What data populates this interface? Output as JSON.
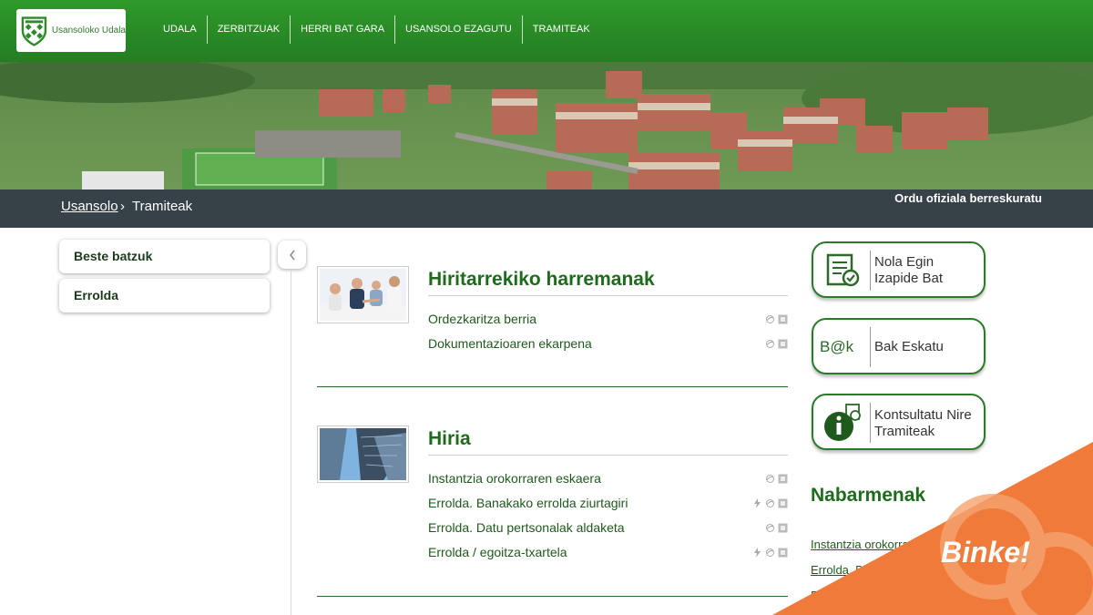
{
  "header": {
    "logo_text": "Usansoloko Udala",
    "nav": [
      "UDALA",
      "ZERBITZUAK",
      "HERRI BAT GARA",
      "USANSOLO EZAGUTU",
      "TRAMITEAK"
    ]
  },
  "breadcrumb": {
    "home": "Usansolo",
    "separator": "›",
    "current": "Tramiteak",
    "ordu": "Ordu ofiziala berreskuratu"
  },
  "sidebar": {
    "items": [
      "Beste batzuk",
      "Errolda"
    ]
  },
  "sections": [
    {
      "title": "Hiritarrekiko harremanak",
      "items": [
        "Ordezkaritza berria",
        "Dokumentazioaren ekarpena"
      ]
    },
    {
      "title": "Hiria",
      "items": [
        "Instantzia orokorraren eskaera",
        "Errolda. Banakako errolda ziurtagiri",
        "Errolda. Datu pertsonalak aldaketa",
        "Errolda / egoitza-txartela"
      ]
    }
  ],
  "right": {
    "buttons": [
      {
        "line1": "Nola Egin",
        "line2": "Izapide Bat",
        "icon": "form-check-icon"
      },
      {
        "line1": "Bak Eskatu",
        "line2": "",
        "icon": "bak-logo-icon"
      },
      {
        "line1": "Kontsultatu Nire",
        "line2": "Tramiteak",
        "icon": "info-icon"
      }
    ],
    "highlights_title": "Nabarmenak",
    "highlights": [
      "Instantzia orokorra",
      "Errolda. B",
      "E"
    ]
  },
  "watermark": "Binke!",
  "colors": {
    "brand_green": "#2b8a27",
    "dark_bar": "#374148",
    "accent_orange": "#f07a3a"
  }
}
